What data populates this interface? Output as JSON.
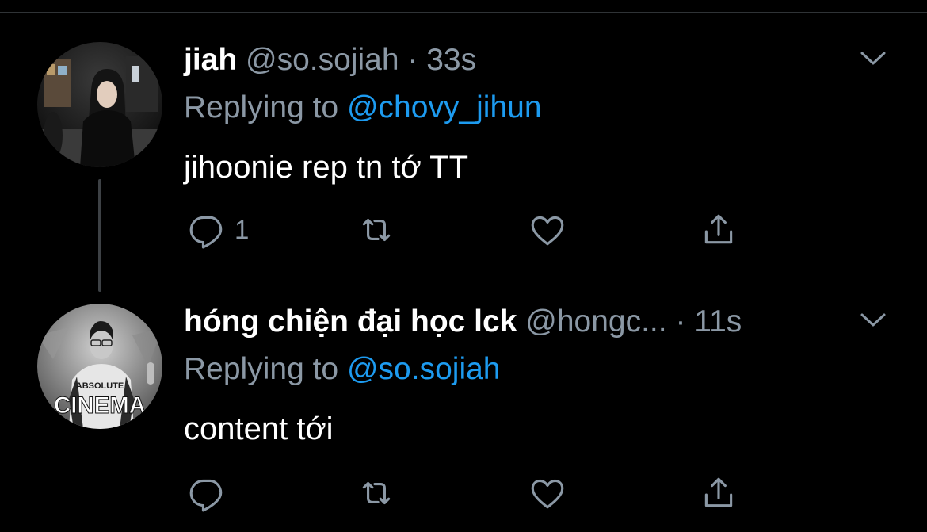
{
  "tweets": [
    {
      "display_name": "jiah",
      "handle": "@so.sojiah",
      "separator": "·",
      "time": "33s",
      "replying_prefix": "Replying to",
      "replying_to": "@chovy_jihun",
      "text": "jihoonie rep tn tớ TT",
      "reply_count": "1",
      "icons": [
        "reply-icon",
        "retweet-icon",
        "like-icon",
        "share-icon",
        "chevron-down-icon"
      ]
    },
    {
      "display_name": "hóng chiện đại học lck",
      "handle": "@hongc...",
      "separator": "·",
      "time": "11s",
      "replying_prefix": "Replying to",
      "replying_to": "@so.sojiah",
      "text": "content tới",
      "reply_count": "",
      "avatar_text_top": "ABSOLUTE",
      "avatar_text_bottom": "CINEMA",
      "icons": [
        "reply-icon",
        "retweet-icon",
        "like-icon",
        "share-icon",
        "chevron-down-icon"
      ]
    }
  ],
  "colors": {
    "background": "#000000",
    "text_primary": "#ffffff",
    "text_secondary": "#8b98a5",
    "link": "#1d9bf0",
    "thread_line": "#3d4145",
    "divider": "#2f3336"
  }
}
